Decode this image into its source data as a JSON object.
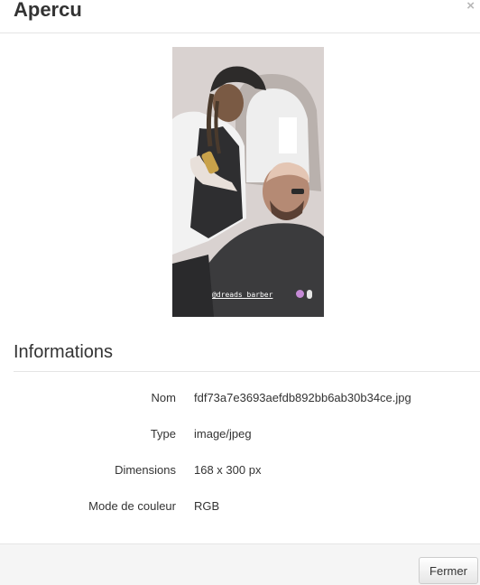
{
  "dialog": {
    "title": "Apercu",
    "close_symbol": "×",
    "close_icon": "close-icon"
  },
  "preview": {
    "caption": "@dreads barber"
  },
  "informations": {
    "heading": "Informations",
    "rows": [
      {
        "label": "Nom",
        "value": "fdf73a7e3693aefdb892bb6ab30b34ce.jpg"
      },
      {
        "label": "Type",
        "value": "image/jpeg"
      },
      {
        "label": "Dimensions",
        "value": "168 x 300 px"
      },
      {
        "label": "Mode de couleur",
        "value": "RGB"
      }
    ]
  },
  "footer": {
    "close_label": "Fermer"
  }
}
